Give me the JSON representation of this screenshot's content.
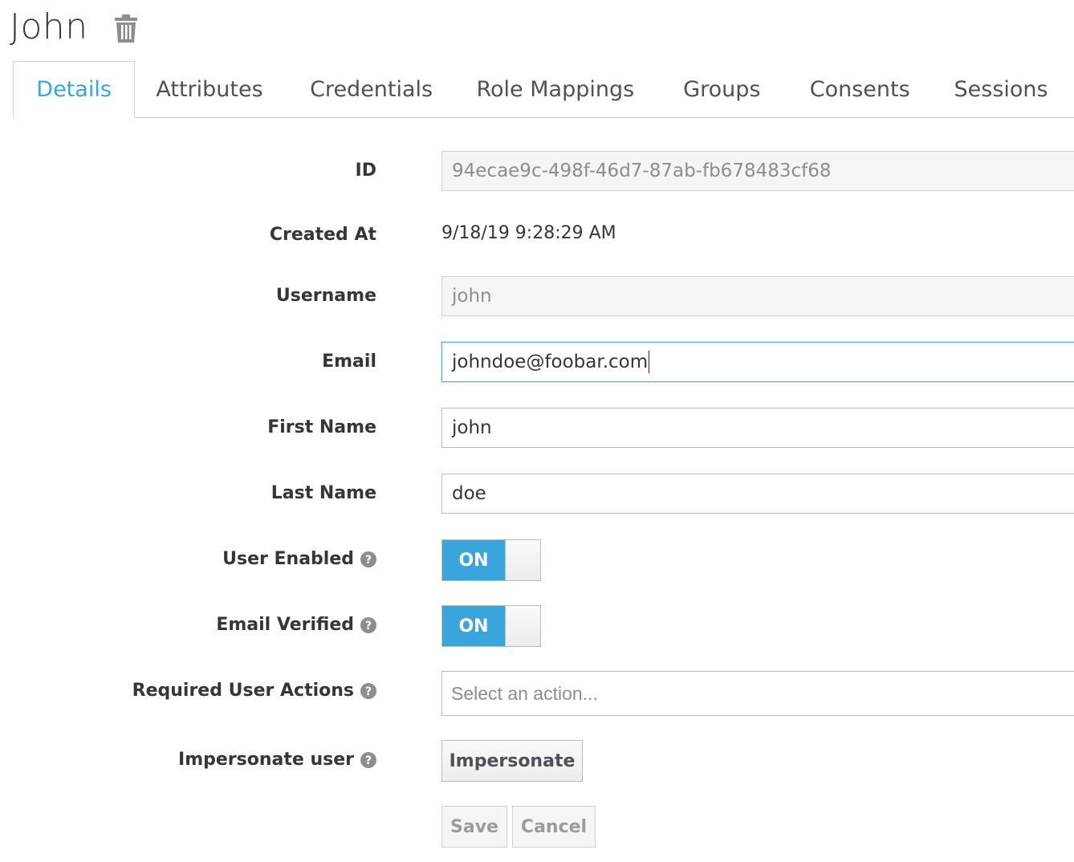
{
  "header": {
    "title": "John",
    "delete_icon": "trash-icon"
  },
  "tabs": [
    {
      "label": "Details",
      "active": true
    },
    {
      "label": "Attributes"
    },
    {
      "label": "Credentials"
    },
    {
      "label": "Role Mappings"
    },
    {
      "label": "Groups"
    },
    {
      "label": "Consents"
    },
    {
      "label": "Sessions"
    }
  ],
  "form": {
    "id": {
      "label": "ID",
      "value": "94ecae9c-498f-46d7-87ab-fb678483cf68"
    },
    "created_at": {
      "label": "Created At",
      "value": "9/18/19 9:28:29 AM"
    },
    "username": {
      "label": "Username",
      "value": "john"
    },
    "email": {
      "label": "Email",
      "value": "johndoe@foobar.com"
    },
    "first_name": {
      "label": "First Name",
      "value": "john"
    },
    "last_name": {
      "label": "Last Name",
      "value": "doe"
    },
    "user_enabled": {
      "label": "User Enabled",
      "state": "ON"
    },
    "email_verified": {
      "label": "Email Verified",
      "state": "ON"
    },
    "required_actions": {
      "label": "Required User Actions",
      "placeholder": "Select an action..."
    },
    "impersonate": {
      "label": "Impersonate user",
      "button": "Impersonate"
    }
  },
  "actions": {
    "save": "Save",
    "cancel": "Cancel"
  },
  "colors": {
    "accent": "#39a5dc",
    "text": "#363636",
    "border": "#bbbbbb"
  }
}
